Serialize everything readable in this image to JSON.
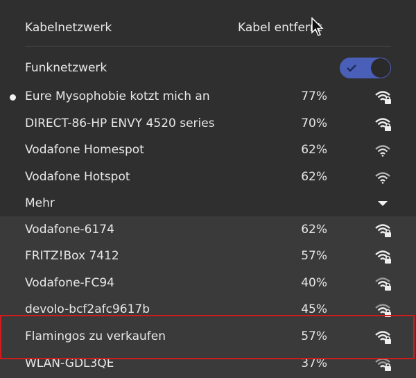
{
  "wired": {
    "label": "Kabelnetzwerk",
    "status": "Kabel entfernt"
  },
  "wireless": {
    "label": "Funknetzwerk",
    "toggle_on": true,
    "toggle_color": "#4a5fb8"
  },
  "networks": [
    {
      "name": "Eure Mysophobie kotzt mich an",
      "signal": "77%",
      "secured": true,
      "connected": true
    },
    {
      "name": "DIRECT-86-HP ENVY 4520 series",
      "signal": "70%",
      "secured": true
    },
    {
      "name": "Vodafone Homespot",
      "signal": "62%",
      "secured": false
    },
    {
      "name": "Vodafone Hotspot",
      "signal": "62%",
      "secured": false
    }
  ],
  "more": {
    "label": "Mehr"
  },
  "more_networks": [
    {
      "name": "Vodafone-6174",
      "signal": "62%",
      "secured": true
    },
    {
      "name": "FRITZ!Box 7412",
      "signal": "57%",
      "secured": true
    },
    {
      "name": "Vodafone-FC94",
      "signal": "40%",
      "secured": true
    },
    {
      "name": "devolo-bcf2afc9617b",
      "signal": "45%",
      "secured": true
    },
    {
      "name": "Flamingos zu verkaufen",
      "signal": "57%",
      "secured": true
    },
    {
      "name": "WLAN-GDL3QE",
      "signal": "37%",
      "secured": true
    }
  ],
  "highlight_color": "#d01c1c"
}
